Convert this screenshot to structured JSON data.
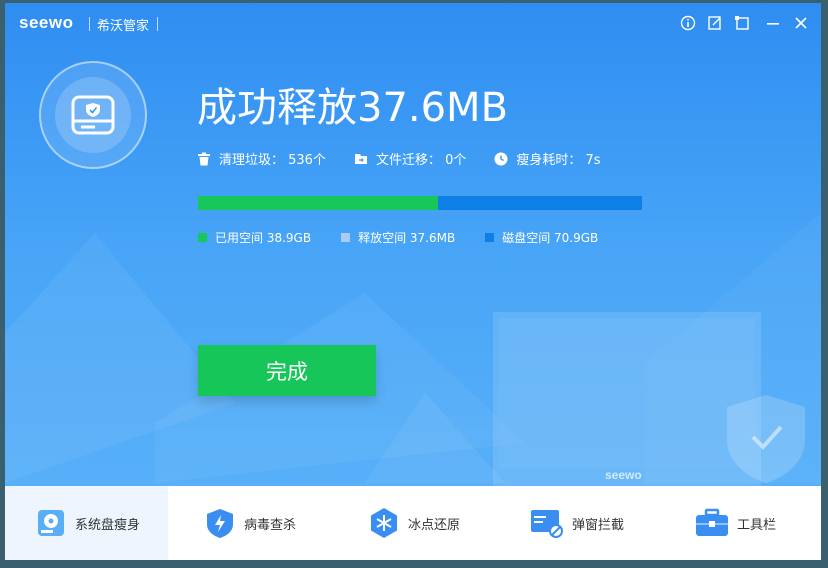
{
  "titlebar": {
    "logo": "seewo",
    "app_name": "希沃管家",
    "buttons": [
      "info-icon",
      "feedback-icon",
      "skin-icon",
      "minimize-icon",
      "close-icon"
    ]
  },
  "headline": "成功释放37.6MB",
  "stats": [
    {
      "icon": "trash-icon",
      "text": "清理垃圾： 536个"
    },
    {
      "icon": "folder-move-icon",
      "text": "文件迁移： 0个"
    },
    {
      "icon": "clock-icon",
      "text": "瘦身耗时： 7s"
    }
  ],
  "usage": {
    "used_fraction": 0.54
  },
  "legend": [
    {
      "label": "已用空间 38.9GB",
      "color": "#16c75a"
    },
    {
      "label": "释放空间 37.6MB",
      "color": "#a9cdf2"
    },
    {
      "label": "磁盘空间 70.9GB",
      "color": "#0d7fe6"
    }
  ],
  "done_button": "完成",
  "watermark": "seewo",
  "nav": [
    {
      "label": "系统盘瘦身",
      "icon": "disk-slim-icon",
      "active": true
    },
    {
      "label": "病毒查杀",
      "icon": "antivirus-shield-icon",
      "active": false
    },
    {
      "label": "冰点还原",
      "icon": "snowflake-icon",
      "active": false
    },
    {
      "label": "弹窗拦截",
      "icon": "popup-block-icon",
      "active": false
    },
    {
      "label": "工具栏",
      "icon": "toolbox-icon",
      "active": false
    }
  ]
}
